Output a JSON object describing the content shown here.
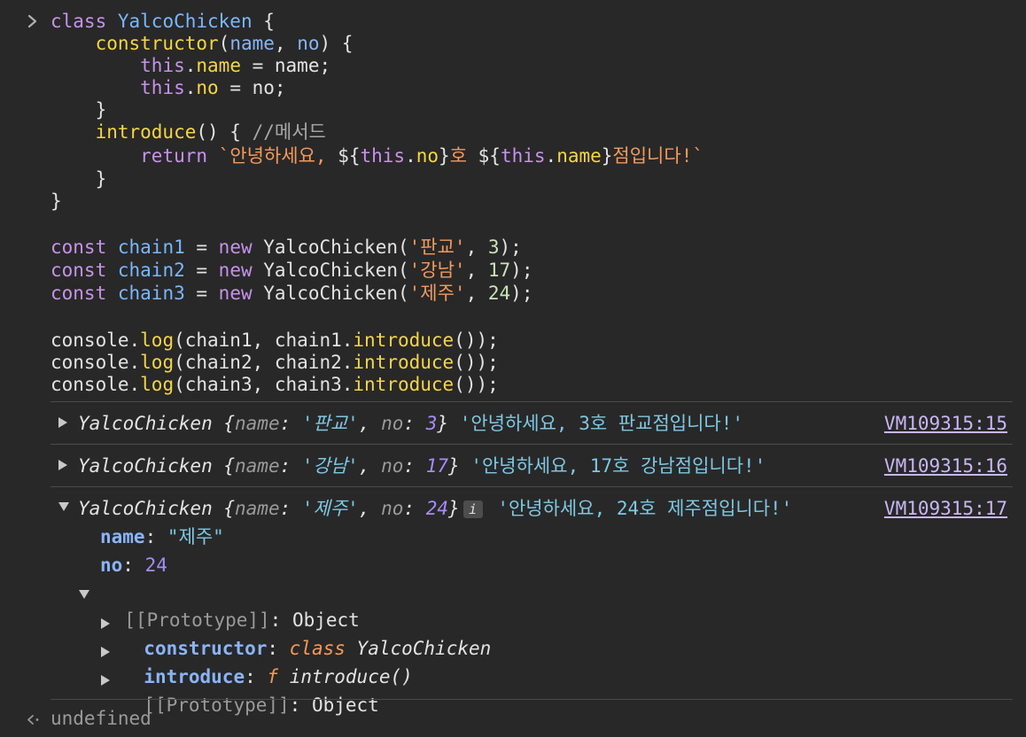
{
  "code": {
    "l1": [
      "class",
      "YalcoChicken",
      "{"
    ],
    "l2": [
      "constructor",
      "(",
      "name",
      ",",
      "no",
      ") {"
    ],
    "l3": [
      "this",
      ".",
      "name",
      " = name;"
    ],
    "l4": [
      "this",
      ".",
      "no",
      " = no;"
    ],
    "l5": [
      "}"
    ],
    "l6": [
      "introduce",
      "() { ",
      "//메서드"
    ],
    "l7": [
      "return",
      "`안녕하세요, ",
      "${",
      "this",
      ".",
      "no",
      "}",
      "호 ",
      "${",
      "this",
      ".",
      "name",
      "}",
      "점입니다!`"
    ],
    "l8": [
      "}"
    ],
    "l9": [
      "}"
    ],
    "decl": [
      {
        "kw": "const",
        "var": "chain1",
        "eq": " = ",
        "new": "new",
        "cls": "YalcoChicken",
        "open": "(",
        "str": "'판교'",
        "comma": ", ",
        "num": "3",
        "close": ");"
      },
      {
        "kw": "const",
        "var": "chain2",
        "eq": " = ",
        "new": "new",
        "cls": "YalcoChicken",
        "open": "(",
        "str": "'강남'",
        "comma": ", ",
        "num": "17",
        "close": ");"
      },
      {
        "kw": "const",
        "var": "chain3",
        "eq": " = ",
        "new": "new",
        "cls": "YalcoChicken",
        "open": "(",
        "str": "'제주'",
        "comma": ", ",
        "num": "24",
        "close": ");"
      }
    ],
    "logs": [
      {
        "pre": "console.",
        "fn": "log",
        "mid": "(chain1, chain1.",
        "call": "introduce",
        "post": "());"
      },
      {
        "pre": "console.",
        "fn": "log",
        "mid": "(chain2, chain2.",
        "call": "introduce",
        "post": "());"
      },
      {
        "pre": "console.",
        "fn": "log",
        "mid": "(chain3, chain3.",
        "call": "introduce",
        "post": "());"
      }
    ]
  },
  "output": [
    {
      "cls": "YalcoChicken",
      "open": " {",
      "k1": "name",
      "c1": ": ",
      "v1": "'판교'",
      "sep": ", ",
      "k2": "no",
      "c2": ": ",
      "v2": "3",
      "close": "}",
      "msg": "'안녕하세요, 3호 판교점입니다!'",
      "src": "VM109315:15"
    },
    {
      "cls": "YalcoChicken",
      "open": " {",
      "k1": "name",
      "c1": ": ",
      "v1": "'강남'",
      "sep": ", ",
      "k2": "no",
      "c2": ": ",
      "v2": "17",
      "close": "}",
      "msg": "'안녕하세요, 17호 강남점입니다!'",
      "src": "VM109315:16"
    },
    {
      "cls": "YalcoChicken",
      "open": " {",
      "k1": "name",
      "c1": ": ",
      "v1": "'제주'",
      "sep": ", ",
      "k2": "no",
      "c2": ": ",
      "v2": "24",
      "close": "}",
      "badge": "i",
      "msg": "'안녕하세요, 24호 제주점입니다!'",
      "src": "VM109315:17"
    }
  ],
  "expanded": {
    "name_key": "name",
    "name_val": "\"제주\"",
    "no_key": "no",
    "no_val": "24",
    "proto_key": "[[Prototype]]",
    "proto_val": "Object",
    "ctor_key": "constructor",
    "ctor_kw": "class",
    "ctor_val": "YalcoChicken",
    "intro_key": "introduce",
    "intro_f": "f",
    "intro_val": "introduce()",
    "proto2_key": "[[Prototype]]",
    "proto2_val": "Object",
    "colon": ": "
  },
  "result": {
    "value": "undefined"
  }
}
